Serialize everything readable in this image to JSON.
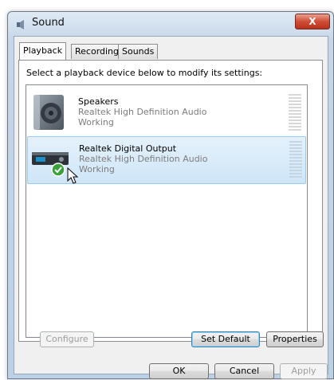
{
  "window": {
    "title": "Sound",
    "close_label": "X"
  },
  "tabs": [
    {
      "label": "Playback",
      "active": true
    },
    {
      "label": "Recording",
      "active": false
    },
    {
      "label": "Sounds",
      "active": false
    }
  ],
  "instruction": "Select a playback device below to modify its settings:",
  "devices": [
    {
      "name": "Speakers",
      "description": "Realtek High Definition Audio",
      "status": "Working",
      "icon": "speaker-icon",
      "selected": false,
      "default": false
    },
    {
      "name": "Realtek Digital Output",
      "description": "Realtek High Definition Audio",
      "status": "Working",
      "icon": "digital-output-icon",
      "selected": true,
      "default": true
    }
  ],
  "panel_buttons": {
    "configure": "Configure",
    "set_default": "Set Default",
    "properties": "Properties"
  },
  "dialog_buttons": {
    "ok": "OK",
    "cancel": "Cancel",
    "apply": "Apply"
  },
  "colors": {
    "selection": "#cfe6f8",
    "title_bar": "#c6d6e8",
    "close_button": "#cf4d35"
  }
}
